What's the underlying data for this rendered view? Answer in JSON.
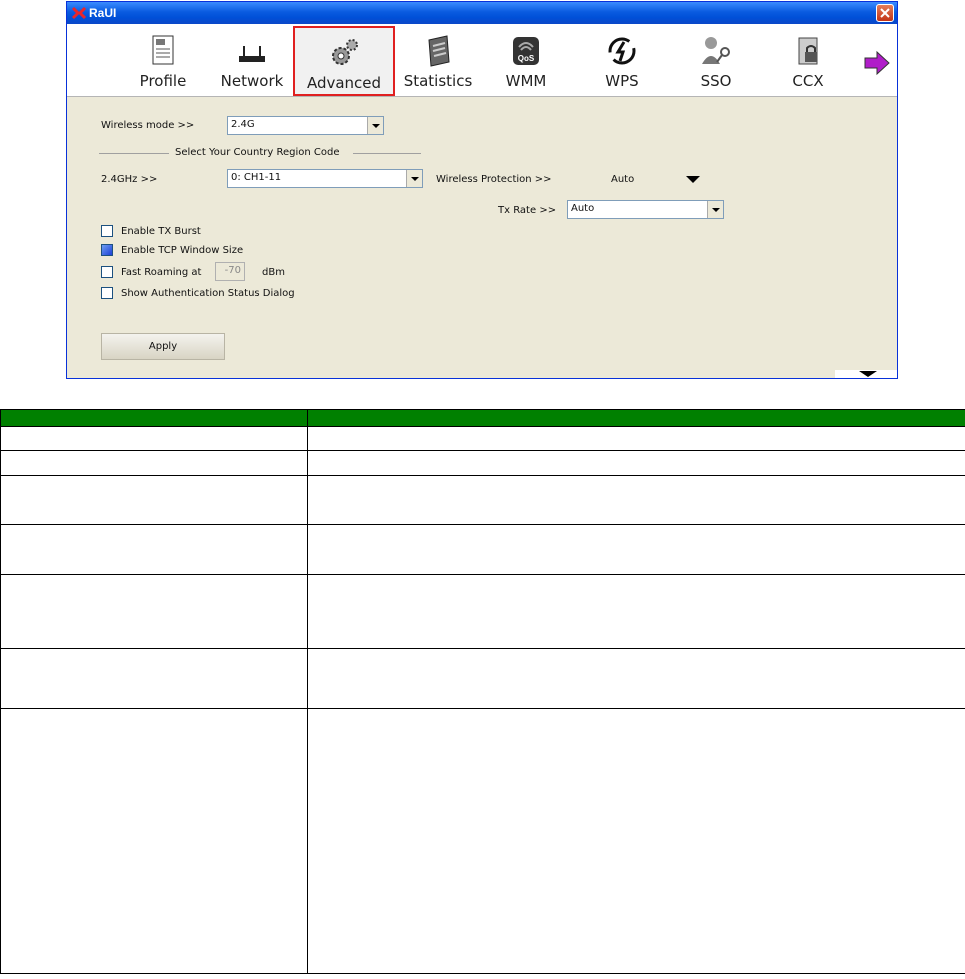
{
  "window": {
    "title": "RaUI"
  },
  "toolbar": {
    "items": [
      {
        "label": "Profile",
        "icon": "profile-icon"
      },
      {
        "label": "Network",
        "icon": "network-icon"
      },
      {
        "label": "Advanced",
        "icon": "gears-icon",
        "selected": true
      },
      {
        "label": "Statistics",
        "icon": "calculator-icon"
      },
      {
        "label": "WMM",
        "icon": "qos-icon",
        "badge": "QoS"
      },
      {
        "label": "WPS",
        "icon": "wps-icon"
      },
      {
        "label": "SSO",
        "icon": "key-user-icon"
      },
      {
        "label": "CCX",
        "icon": "ccx-icon"
      }
    ]
  },
  "advanced": {
    "wireless_mode_label": "Wireless mode >>",
    "wireless_mode_value": "2.4G",
    "country_section_title": "Select Your Country Region Code",
    "band_label": "2.4GHz >>",
    "band_value": "0: CH1-11",
    "protection_label": "Wireless Protection >>",
    "protection_value": "Auto",
    "tx_rate_label": "Tx Rate >>",
    "tx_rate_value": "Auto",
    "options": [
      {
        "label": "Enable TX Burst",
        "checked": false
      },
      {
        "label": "Enable TCP Window Size",
        "checked": true
      },
      {
        "label": "Fast Roaming at",
        "checked": false
      },
      {
        "label": "Show Authentication Status Dialog",
        "checked": false
      }
    ],
    "roaming_value": "-70",
    "roaming_unit": "dBm",
    "apply_label": "Apply"
  },
  "colors": {
    "header_green": "#008000",
    "title_blue": "#0a5be0",
    "selected_border": "#e02020"
  }
}
